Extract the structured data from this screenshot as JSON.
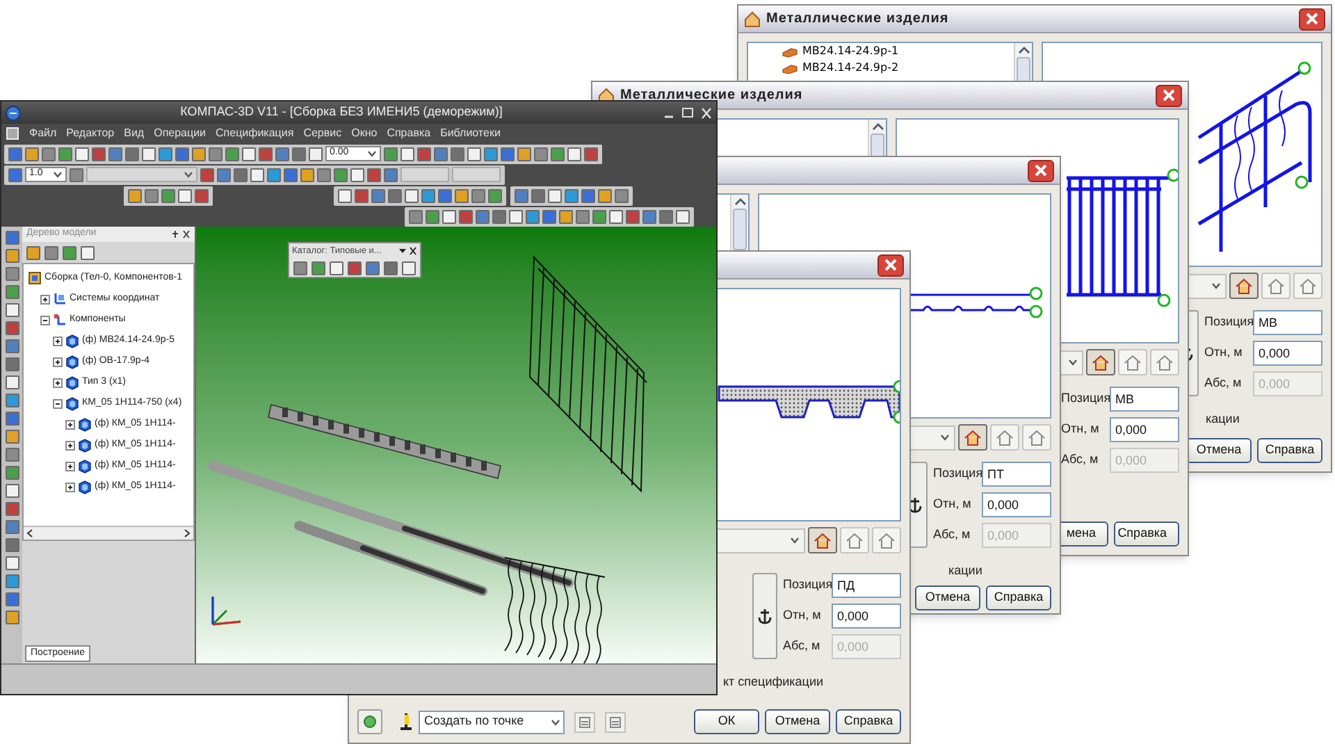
{
  "main_window": {
    "title": "КОМПАС-3D V11 - [Сборка БЕЗ ИМЕНИ5 (деморежим)]",
    "menu": [
      "Файл",
      "Редактор",
      "Вид",
      "Операции",
      "Спецификация",
      "Сервис",
      "Окно",
      "Справка",
      "Библиотеки"
    ],
    "zoom_value": "0.00",
    "line_width_value": "1.0",
    "model_tree": {
      "title": "Дерево модели",
      "items": [
        {
          "label": "Сборка (Тел-0, Компонентов-1",
          "kind": "assembly",
          "children": [
            {
              "label": "Системы координат",
              "kind": "axes",
              "expanded": false
            },
            {
              "label": "Компоненты",
              "kind": "folder",
              "expanded": true,
              "children": [
                {
                  "label": "(ф) МВ24.14-24.9р-5",
                  "kind": "part",
                  "expanded": false
                },
                {
                  "label": "(ф) ОВ-17.9р-4",
                  "kind": "part",
                  "expanded": false
                },
                {
                  "label": "Тип 3 (х1)",
                  "kind": "part",
                  "expanded": false
                },
                {
                  "label": "КМ_05 1Н114-750 (х4)",
                  "kind": "part",
                  "expanded": true,
                  "children": [
                    {
                      "label": "(ф) КМ_05 1Н114-",
                      "kind": "part",
                      "expanded": false
                    },
                    {
                      "label": "(ф) КМ_05 1Н114-",
                      "kind": "part",
                      "expanded": false
                    },
                    {
                      "label": "(ф) КМ_05 1Н114-",
                      "kind": "part",
                      "expanded": false
                    },
                    {
                      "label": "(ф) КМ_05 1Н114-",
                      "kind": "part",
                      "expanded": false
                    }
                  ]
                }
              ]
            }
          ]
        }
      ]
    },
    "tab": "Построение",
    "catalog_panel": {
      "title": "Каталог: Типовые и..."
    }
  },
  "dialogs": [
    {
      "title": "Металлические изделия",
      "list_items": [
        {
          "label": "МВ24.14-24.9р-1",
          "selected": false
        },
        {
          "label": "МВ24.14-24.9р-2",
          "selected": false
        }
      ],
      "view_buttons": [
        {
          "selected": true
        },
        {
          "selected": false
        },
        {
          "selected": false
        }
      ],
      "fields": [
        {
          "label": "Позиция",
          "value": "МВ",
          "disabled": false
        },
        {
          "label": "Отн, м",
          "value": "0,000",
          "disabled": false
        },
        {
          "label": "Абс, м",
          "value": "0,000",
          "disabled": true
        }
      ],
      "spec_text": "кации",
      "buttons": [
        "Отмена",
        "Справка"
      ]
    },
    {
      "title": "Металлические изделия",
      "view_buttons": [
        {
          "selected": true
        },
        {
          "selected": false
        },
        {
          "selected": false
        }
      ],
      "fields": [
        {
          "label": "Позиция",
          "value": "МВ",
          "disabled": false
        },
        {
          "label": "Отн, м",
          "value": "0,000",
          "disabled": false
        },
        {
          "label": "Абс, м",
          "value": "0,000",
          "disabled": true
        }
      ],
      "buttons": [
        "мена",
        "Справка"
      ]
    },
    {
      "view_buttons": [
        {
          "selected": true
        },
        {
          "selected": false
        },
        {
          "selected": false
        }
      ],
      "fields": [
        {
          "label": "Позиция",
          "value": "ПТ",
          "disabled": false
        },
        {
          "label": "Отн, м",
          "value": "0,000",
          "disabled": false
        },
        {
          "label": "Абс, м",
          "value": "0,000",
          "disabled": true
        }
      ],
      "spec_text": "кации",
      "buttons": [
        "Отмена",
        "Справка"
      ]
    },
    {
      "view_buttons": [
        {
          "selected": true
        },
        {
          "selected": false
        },
        {
          "selected": false
        }
      ],
      "fields": [
        {
          "label": "Позиция",
          "value": "ПД",
          "disabled": false
        },
        {
          "label": "Отн, м",
          "value": "0,000",
          "disabled": false
        },
        {
          "label": "Абс, м",
          "value": "0,000",
          "disabled": true
        }
      ],
      "spec_text": "кт спецификации",
      "create_mode": "Создать по точке",
      "buttons": [
        "ОК",
        "Отмена",
        "Справка"
      ]
    }
  ]
}
